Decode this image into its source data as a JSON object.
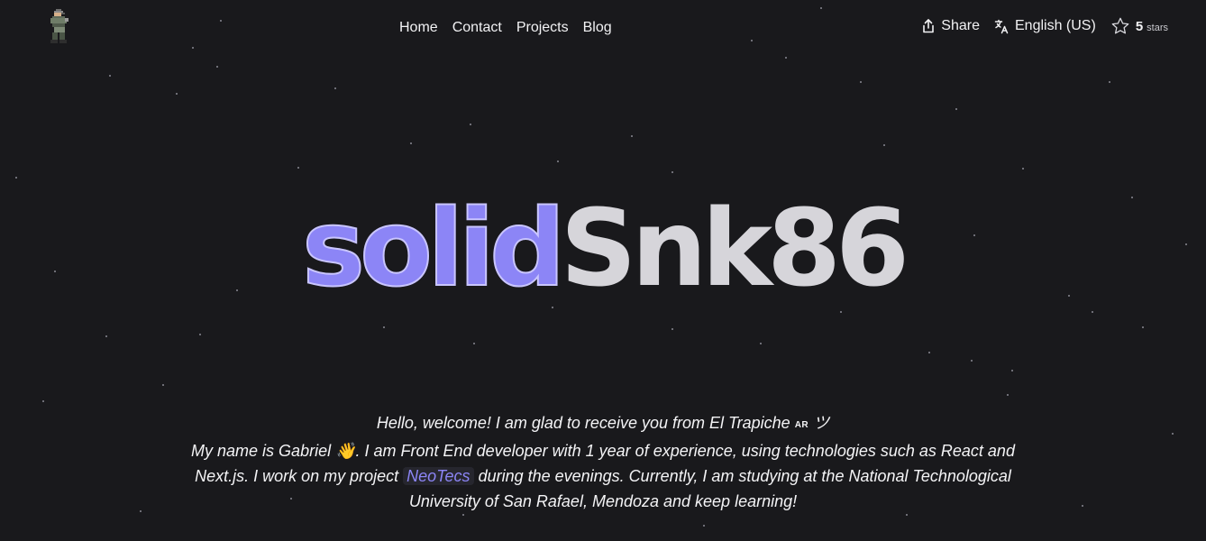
{
  "header": {
    "logo_icon": "pixel-soldier-icon",
    "nav": [
      {
        "label": "Home"
      },
      {
        "label": "Contact"
      },
      {
        "label": "Projects"
      },
      {
        "label": "Blog"
      }
    ],
    "share_label": "Share",
    "share_icon": "share-icon",
    "language_label": "English (US)",
    "language_icon": "translate-icon",
    "star_icon": "star-outline-icon",
    "stars_count": "5",
    "stars_word": "stars"
  },
  "hero": {
    "part1": "solid",
    "part2": "Snk86",
    "part1_color": "#8c85f6",
    "part2_color": "#d6d5da"
  },
  "intro": {
    "line1": "Hello, welcome! I am glad to receive you from El Trapiche",
    "flag_code": "AR",
    "smile": "ツ",
    "p1": "My name is Gabriel",
    "wave": "👋",
    "p2": ". I am Front End developer with 1 year of experience, using technologies such as React and Next.js. I work on my project",
    "project_link": "NeoTecs",
    "p3": "during the evenings. Currently, I am studying at the National Technological University of San Rafael, Mendoza and keep learning!"
  },
  "colors": {
    "background": "#19191c",
    "accent": "#8c85f6"
  }
}
